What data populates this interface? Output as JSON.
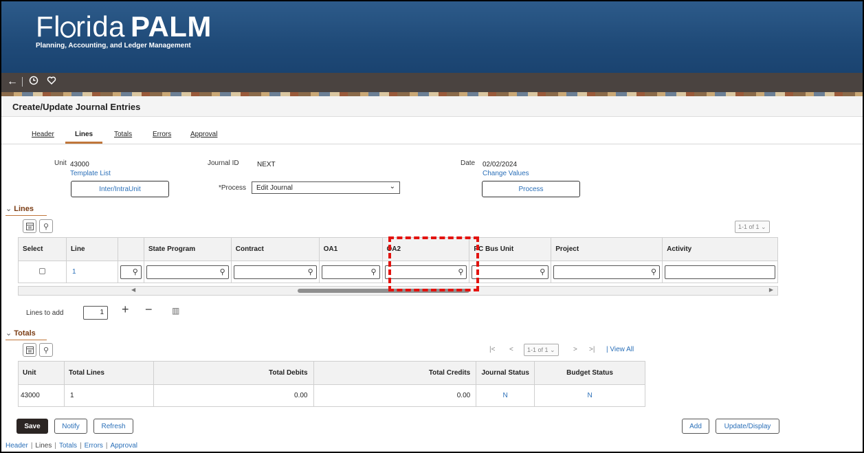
{
  "banner": {
    "logo_pre": "Fl",
    "logo_mid": "rida",
    "logo_bold": "PALM",
    "subtitle": "Planning, Accounting, and Ledger Management"
  },
  "nav": {
    "back_icon": "back-arrow-icon",
    "history_icon": "clock-icon",
    "favorite_icon": "heart-icon"
  },
  "page_title": "Create/Update Journal Entries",
  "tabs": [
    "Header",
    "Lines",
    "Totals",
    "Errors",
    "Approval"
  ],
  "active_tab": "Lines",
  "header": {
    "unit_label": "Unit",
    "unit_value": "43000",
    "template_list": "Template List",
    "inter_button": "Inter/IntraUnit",
    "journal_id_label": "Journal ID",
    "journal_id_value": "NEXT",
    "process_label": "*Process",
    "process_value": "Edit Journal",
    "date_label": "Date",
    "date_value": "02/02/2024",
    "change_values": "Change Values",
    "process_button": "Process"
  },
  "lines": {
    "section_title": "Lines",
    "pager": "1-1 of 1",
    "columns": [
      "Select",
      "Line",
      "",
      "State Program",
      "Contract",
      "OA1",
      "OA2",
      "PC Bus Unit",
      "Project",
      "Activity"
    ],
    "rows": [
      {
        "line": "1"
      }
    ],
    "lines_to_add_label": "Lines to add",
    "lines_to_add_value": "1"
  },
  "totals": {
    "section_title": "Totals",
    "pager": "1-1 of 1",
    "view_all": "View All",
    "columns": [
      "Unit",
      "Total Lines",
      "Total Debits",
      "Total Credits",
      "Journal Status",
      "Budget Status"
    ],
    "rows": [
      {
        "unit": "43000",
        "total_lines": "1",
        "total_debits": "0.00",
        "total_credits": "0.00",
        "journal_status": "N",
        "budget_status": "N"
      }
    ]
  },
  "actions": {
    "save": "Save",
    "notify": "Notify",
    "refresh": "Refresh",
    "add": "Add",
    "update_display": "Update/Display"
  },
  "footer_links": [
    "Header",
    "Lines",
    "Totals",
    "Errors",
    "Approval"
  ],
  "colors": {
    "banner": "#1f4a78",
    "accent": "#c0763a",
    "link": "#2a6fb8",
    "highlight": "#e3130f"
  }
}
